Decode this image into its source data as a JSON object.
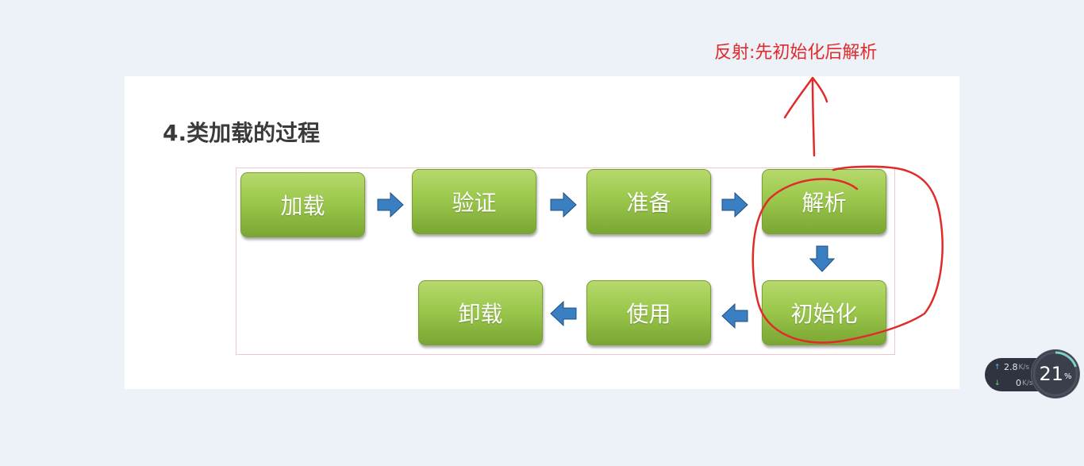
{
  "annotation": {
    "text": "反射:先初始化后解析",
    "color": "#e02b2b"
  },
  "slide": {
    "title": "4.类加载的过程",
    "steps": {
      "load": "加载",
      "verify": "验证",
      "prepare": "准备",
      "resolve": "解析",
      "initialize": "初始化",
      "use": "使用",
      "unload": "卸载"
    },
    "colors": {
      "step_fill": "#9bc84c",
      "arrow_fill": "#3a7fc1"
    }
  },
  "net_widget": {
    "upload": "2.8",
    "upload_unit": "K/s",
    "download": "0",
    "download_unit": "K/s",
    "cpu": "21",
    "cpu_unit": "%"
  }
}
